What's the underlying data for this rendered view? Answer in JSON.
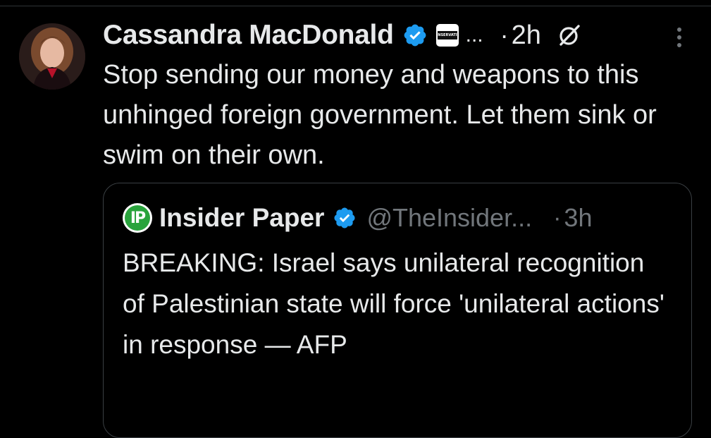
{
  "tweet": {
    "author_name": "Cassandra MacDonald",
    "affiliate_badge_text": "CONSERVATIVE",
    "truncation": "...",
    "separator": "·",
    "time": "2h",
    "text": "Stop sending our money and weapons to this unhinged foreign government. Let them sink or swim on their own.",
    "icons": {
      "verified": "verified-badge-icon",
      "grok": "grok-icon",
      "more": "more-options-icon"
    }
  },
  "quote": {
    "avatar_text": "IP",
    "author_name": "Insider Paper",
    "handle": "@TheInsider...",
    "separator": "·",
    "time": "3h",
    "text": "BREAKING: Israel says unilateral recognition of Palestinian state will force 'unilateral actions' in response — AFP"
  },
  "colors": {
    "background": "#000000",
    "text_primary": "#e7e9ea",
    "text_secondary": "#71767b",
    "verified_blue": "#1d9bf0",
    "border": "#3a3f43",
    "insider_paper_green": "#29a33c"
  }
}
